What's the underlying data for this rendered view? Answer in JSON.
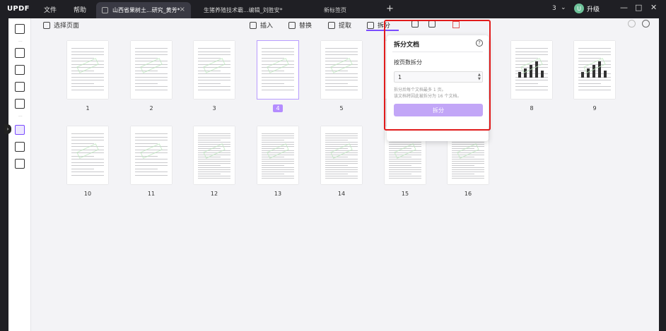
{
  "app": {
    "logo": "UPDF",
    "menu": {
      "file": "文件",
      "help": "帮助"
    },
    "tabs": [
      {
        "label": "山西省果树土...研究_黄芳*"
      },
      {
        "label": "生猪养殖技术霸...编辑_刘胜安*"
      },
      {
        "label": "新标签页"
      }
    ],
    "counter": "3",
    "upgrade": {
      "avatar": "U",
      "label": "升级"
    }
  },
  "toolbar": {
    "select_pages": "选择页面",
    "insert": "插入",
    "replace": "替换",
    "extract": "提取",
    "split": "拆分"
  },
  "pages": [
    "1",
    "2",
    "3",
    "4",
    "5",
    "6",
    "7",
    "8",
    "9",
    "10",
    "11",
    "12",
    "13",
    "14",
    "15",
    "16"
  ],
  "selected_page": "4",
  "split_popup": {
    "title": "拆分文档",
    "help": "?",
    "mode_label": "按页数拆分",
    "input_value": "1",
    "hint_line1": "拆分后每个文档最多 1 页。",
    "hint_line2": "该文档将因此被拆分为 16 个文档。",
    "button": "拆分"
  },
  "colors": {
    "accent": "#7a4cff",
    "highlight_border": "#e11b1b",
    "split_button": "#c2a6f7"
  }
}
